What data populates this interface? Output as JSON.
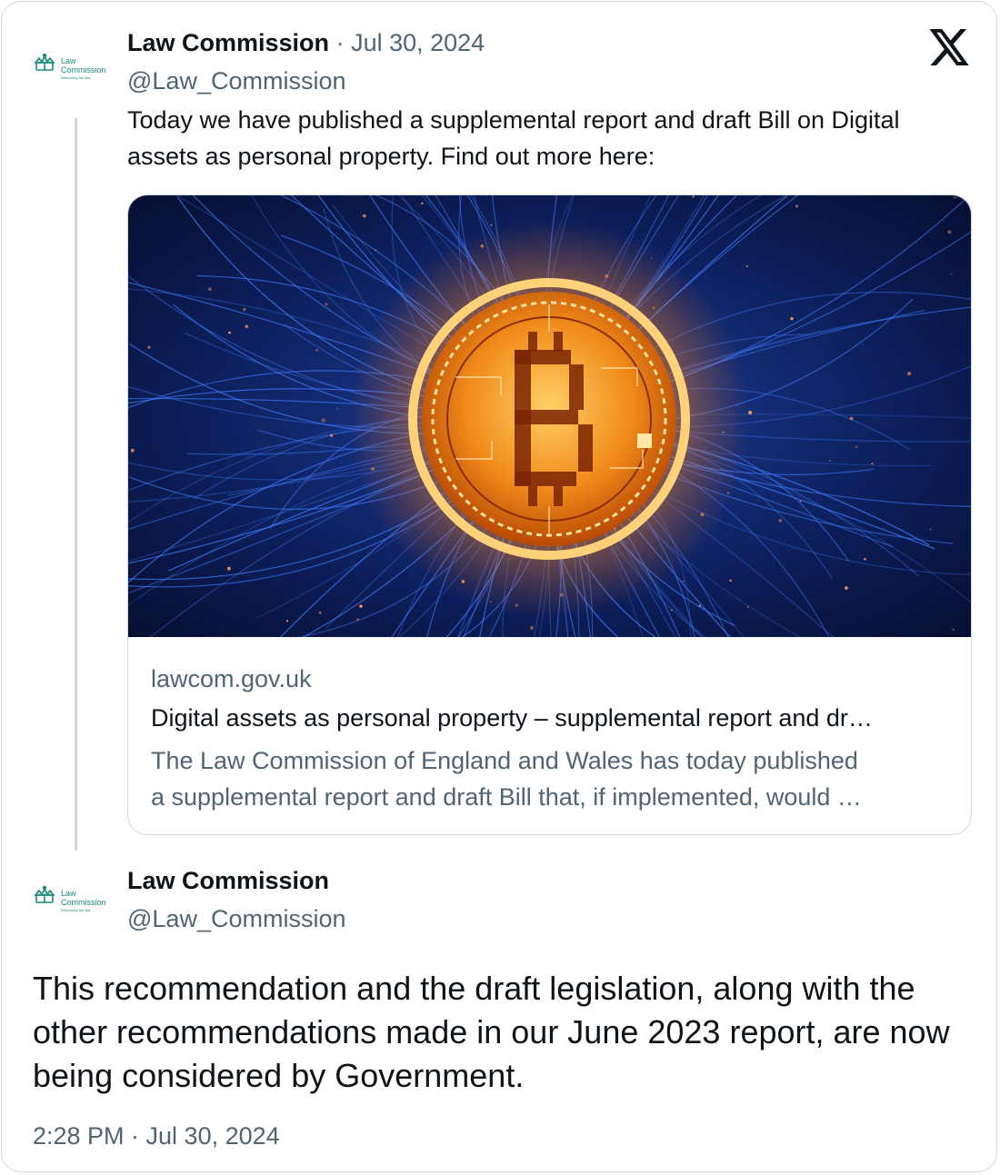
{
  "quoted_tweet": {
    "author_name": "Law Commission",
    "separator": "·",
    "date": "Jul 30, 2024",
    "handle": "@Law_Commission",
    "text": "Today we have published a supplemental report and draft Bill on Digital assets as personal property. Find out more here:",
    "avatar": {
      "logo_line1": "Law",
      "logo_line2": "Commission",
      "logo_tagline": "Reforming the law",
      "icon": "crown-icon",
      "color": "#1b8a7a"
    },
    "link_card": {
      "domain": "lawcom.gov.uk",
      "title": "Digital assets as personal property – supplemental report and dr…",
      "description_line1": "The Law Commission of England and Wales has today published",
      "description_line2": "a supplemental report and draft Bill that, if implemented, would …",
      "image": "glowing-bitcoin-circuit-image"
    }
  },
  "main_tweet": {
    "author_name": "Law Commission",
    "handle": "@Law_Commission",
    "text": "This recommendation and the draft legislation, along with the other recommendations made in our June 2023 report, are now being considered by Government.",
    "timestamp": "2:28 PM · Jul 30, 2024"
  },
  "branding": {
    "icon": "x-logo-icon"
  },
  "colors": {
    "text_primary": "#0f1419",
    "text_secondary": "#536471",
    "border": "#cfd9de",
    "brand_green": "#1b8a7a"
  }
}
